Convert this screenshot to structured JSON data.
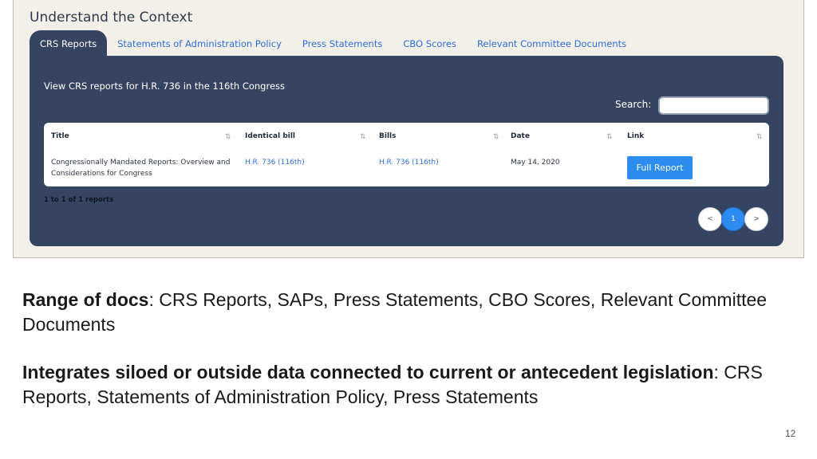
{
  "screenshot": {
    "title": "Understand the Context",
    "tabs": [
      {
        "label": "CRS Reports",
        "active": true
      },
      {
        "label": "Statements of Administration Policy",
        "active": false
      },
      {
        "label": "Press Statements",
        "active": false
      },
      {
        "label": "CBO Scores",
        "active": false
      },
      {
        "label": "Relevant Committee Documents",
        "active": false
      }
    ],
    "panel": {
      "heading": "View CRS reports for H.R. 736 in the 116th Congress",
      "search_label": "Search:",
      "search_value": "",
      "columns": [
        "Title",
        "Identical bill",
        "Bills",
        "Date",
        "Link"
      ],
      "sort_icon": "⇅",
      "rows": [
        {
          "title_line1": "Congressionally Mandated Reports: Overview and",
          "title_line2": "Considerations for Congress",
          "identical_bill": "H.R. 736 (116th)",
          "bills": "H.R. 736 (116th)",
          "date": "May 14, 2020",
          "link_label": "Full Report"
        }
      ],
      "count_text": "1 to 1 of 1 reports",
      "pager": {
        "prev": "<",
        "current": "1",
        "next": ">"
      }
    }
  },
  "slide": {
    "p1_bold": "Range of docs",
    "p1_text": ": CRS Reports, SAPs, Press Statements, CBO Scores, Relevant Committee Documents",
    "p2_bold": "Integrates siloed or outside data connected to current or antecedent legislation",
    "p2_text": ": CRS Reports, Statements of Administration Policy, Press Statements",
    "page_number": "12"
  },
  "colors": {
    "panel": "#354460",
    "accent": "#2d8cf0",
    "tab_link": "#2e6fd6"
  }
}
